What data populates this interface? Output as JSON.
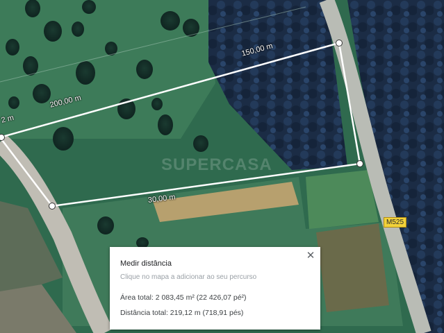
{
  "map": {
    "watermark": "SUPERCASA",
    "road_label": "M525",
    "segment_labels": {
      "top": "150,00 m",
      "upper_left": "200,00 m",
      "left_edge": "2 m",
      "bottom": "30,00 m"
    }
  },
  "measure_panel": {
    "title": "Medir distância",
    "hint": "Clique no mapa a adicionar ao seu percurso",
    "area_total": "Área total: 2 083,45 m² (22 426,07 pé²)",
    "distance_total": "Distância total: 219,12 m (718,91 pés)",
    "close_icon": "close-icon"
  },
  "colors": {
    "measure_line": "#ffffff",
    "road_badge": "#f2d23a",
    "field": "#2f6a4a",
    "forest": "#1b2f45"
  }
}
